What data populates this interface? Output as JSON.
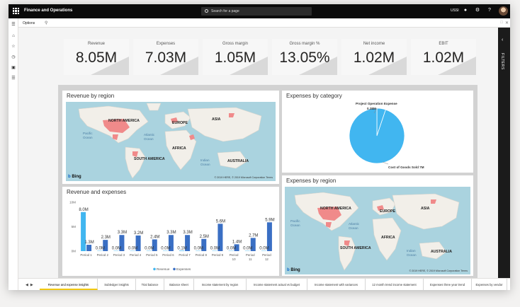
{
  "app": {
    "title": "Finance and Operations",
    "search_placeholder": "Search for a page",
    "company": "USSI"
  },
  "options": {
    "label": "Options"
  },
  "filters": {
    "label": "FILTERS"
  },
  "kpis": [
    {
      "label": "Revenue",
      "value": "8.05M"
    },
    {
      "label": "Expenses",
      "value": "7.03M"
    },
    {
      "label": "Gross margin",
      "value": "1.05M"
    },
    {
      "label": "Gross margin %",
      "value": "13.05%"
    },
    {
      "label": "Net income",
      "value": "1.02M"
    },
    {
      "label": "EBIT",
      "value": "1.02M"
    }
  ],
  "revenue_by_region": {
    "title": "Revenue by region",
    "labels": {
      "north_america": "NORTH AMERICA",
      "europe": "EUROPE",
      "asia": "ASIA",
      "pacific": "Pacific",
      "ocean": "Ocean",
      "atlantic": "Atlantic",
      "africa": "AFRICA",
      "south_america": "SOUTH AMERICA",
      "indian": "Indian",
      "australia": "AUSTRALIA"
    },
    "bing": "Bing",
    "copyright": "© 2019 HERE, © 2019 Microsoft Corporation Terms"
  },
  "expenses_by_region": {
    "title": "Expenses by region",
    "labels": {
      "north_america": "NORTH AMERICA",
      "europe": "EUROPE",
      "asia": "ASIA",
      "pacific": "Pacific",
      "ocean": "Ocean",
      "atlantic": "Atlantic",
      "africa": "AFRICA",
      "south_america": "SOUTH AMERICA",
      "indian": "Indian",
      "australia": "AUSTRALIA"
    },
    "bing": "Bing",
    "copyright": "© 2019 HERE, © 2019 Microsoft Corporation Terms"
  },
  "expenses_by_category": {
    "title": "Expenses by category"
  },
  "revenue_and_expenses": {
    "title": "Revenue and expenses"
  },
  "colors": {
    "revenue": "#41b6f0",
    "expenses": "#3a6fc4",
    "pie": "#41b6f0",
    "accent": "#f2c80f"
  },
  "tabs": [
    "Revenue and expense insights",
    "Subledger insights",
    "Trial balance",
    "Balance sheet",
    "Income statement by region",
    "Income statement actual vs budget",
    "Income statement with variances",
    "12 month trend income statement",
    "Expenses three year trend",
    "Expenses by vendor"
  ],
  "chart_data": [
    {
      "type": "pie",
      "title": "Expenses by category",
      "slices": [
        {
          "label": "Project Operation Expense",
          "value": 0.38,
          "display": "0.38M"
        },
        {
          "label": "Cost of Goods Sold",
          "value": 7,
          "display": "7M"
        }
      ]
    },
    {
      "type": "bar",
      "title": "Revenue and expenses",
      "categories": [
        "Period 1",
        "Period 2",
        "Period 3",
        "Period 4",
        "Period 5",
        "Period 6",
        "Period 7",
        "Period 8",
        "Period 9",
        "Period 10",
        "Period 11",
        "Period 12"
      ],
      "series": [
        {
          "name": "Revenue",
          "values": [
            8.0,
            0.0,
            0.0,
            0.0,
            0.0,
            0.0,
            0.1,
            0.0,
            0.0,
            0.0,
            0.0,
            0.0
          ],
          "labels": [
            "8.0M",
            "0.0M",
            "0.0M",
            "0.0M",
            "0.0M",
            "0.0M",
            "0.1M",
            "0.0M",
            "0.0M",
            "0.0M",
            "0.0M",
            "0.0M"
          ]
        },
        {
          "name": "Expenses",
          "values": [
            1.3,
            2.3,
            3.3,
            3.2,
            2.4,
            3.3,
            3.3,
            2.5,
            5.6,
            1.4,
            2.7,
            5.9
          ],
          "labels": [
            "1.3M",
            "2.3M",
            "3.3M",
            "3.2M",
            "2.4M",
            "3.3M",
            "3.3M",
            "2.5M",
            "5.6M",
            "1.4M",
            "2.7M",
            "5.9M"
          ]
        }
      ],
      "yticks": [
        "0M",
        "5M",
        "10M"
      ],
      "ylim": [
        0,
        10
      ]
    }
  ]
}
